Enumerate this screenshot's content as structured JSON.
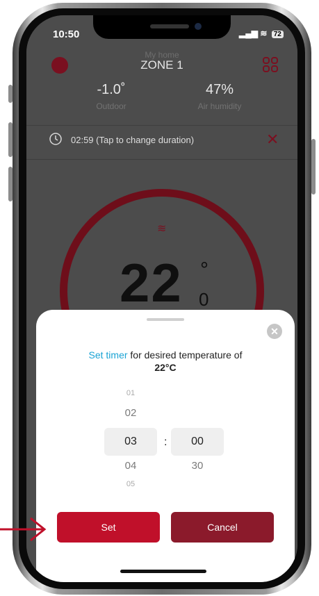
{
  "status_bar": {
    "time": "10:50",
    "battery": "72"
  },
  "header": {
    "subtitle": "My home",
    "title": "ZONE 1"
  },
  "stats": [
    {
      "value": "-1.0˚",
      "label": "Outdoor"
    },
    {
      "value": "47%",
      "label": "Air humidity"
    }
  ],
  "timer_bar": {
    "text": "02:59 (Tap to change duration)"
  },
  "thermostat": {
    "whole": "22",
    "degree": "°",
    "decimal": "0"
  },
  "sheet": {
    "prompt_link": "Set timer",
    "prompt_rest": " for desired temperature of",
    "prompt_temp": "22°C",
    "hours": {
      "above2": "01",
      "above1": "02",
      "selected": "03",
      "below1": "04",
      "below2": "05"
    },
    "minutes": {
      "selected": "00",
      "below1": "30"
    },
    "separator": ":",
    "set_label": "Set",
    "cancel_label": "Cancel"
  },
  "colors": {
    "accent": "#c0102a",
    "cancel": "#8b1a2b",
    "link": "#1aa3d4"
  }
}
